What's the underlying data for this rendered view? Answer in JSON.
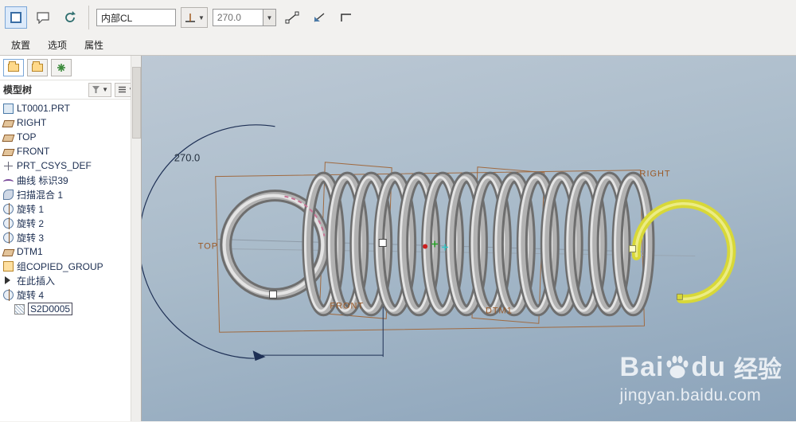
{
  "toolbar": {
    "trajectory_field": {
      "value": "内部CL"
    },
    "angle_field": {
      "value": "270.0"
    },
    "tabs": [
      "放置",
      "选项",
      "属性"
    ]
  },
  "sidebar": {
    "tree_title": "模型树",
    "items": [
      {
        "label": "LT0001.PRT",
        "icon": "part",
        "indent": 0
      },
      {
        "label": "RIGHT",
        "icon": "datum-plane",
        "indent": 0
      },
      {
        "label": "TOP",
        "icon": "datum-plane",
        "indent": 0
      },
      {
        "label": "FRONT",
        "icon": "datum-plane",
        "indent": 0
      },
      {
        "label": "PRT_CSYS_DEF",
        "icon": "csys",
        "indent": 0
      },
      {
        "label": "曲线 标识39",
        "icon": "curve",
        "indent": 0
      },
      {
        "label": "扫描混合 1",
        "icon": "sweep",
        "indent": 0
      },
      {
        "label": "旋转 1",
        "icon": "revolve",
        "indent": 0
      },
      {
        "label": "旋转 2",
        "icon": "revolve",
        "indent": 0
      },
      {
        "label": "旋转 3",
        "icon": "revolve",
        "indent": 0
      },
      {
        "label": "DTM1",
        "icon": "datum-plane",
        "indent": 0
      },
      {
        "label": "组COPIED_GROUP",
        "icon": "group",
        "indent": 0
      },
      {
        "label": "在此插入",
        "icon": "insert",
        "indent": 0
      },
      {
        "label": "旋转 4",
        "icon": "revolve",
        "indent": 0
      },
      {
        "label": "S2D0005",
        "icon": "sketch",
        "indent": 1,
        "boxed": true
      }
    ]
  },
  "viewport": {
    "dimension_value": "270.0",
    "datum_labels": {
      "top": "TOP",
      "front": "FRONT",
      "dtm1": "DTM1",
      "right": "RIGHT"
    },
    "watermark": {
      "brand_left": "Bai",
      "brand_right": "du",
      "brand_cn": "经验",
      "url": "jingyan.baidu.com"
    }
  },
  "colors": {
    "plane_edge": "#a06a40",
    "datum_label": "#9a5a28",
    "dimension_line": "#1e3055",
    "hook_yellow": "#d8d838",
    "spring_gray": "#b2b2b2"
  }
}
